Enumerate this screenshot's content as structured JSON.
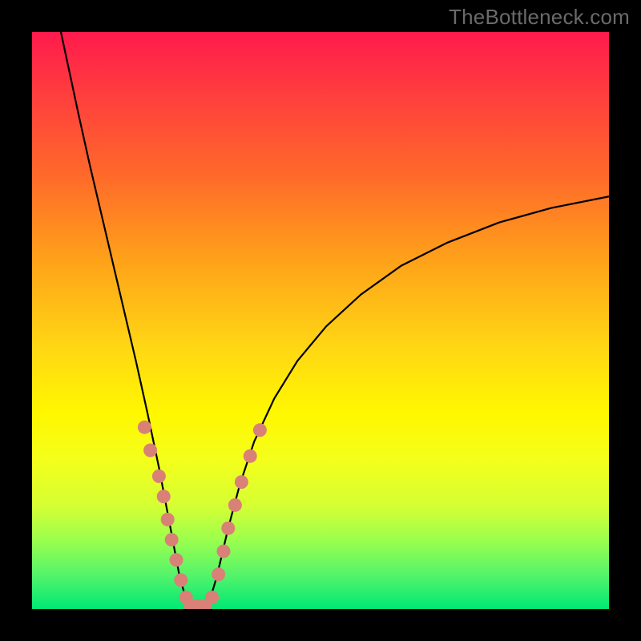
{
  "watermark": "TheBottleneck.com",
  "chart_data": {
    "type": "line",
    "title": "",
    "xlabel": "",
    "ylabel": "",
    "xlim": [
      0,
      100
    ],
    "ylim": [
      0,
      100
    ],
    "curve": {
      "description": "V-shaped bottleneck curve; vertex near x≈27, y≈0; steep left branch rising to top-left; shallower right branch rising to ≈(100,70).",
      "left_branch": [
        {
          "x": 5.0,
          "y": 100.0
        },
        {
          "x": 6.5,
          "y": 93.0
        },
        {
          "x": 8.0,
          "y": 86.0
        },
        {
          "x": 10.0,
          "y": 77.0
        },
        {
          "x": 12.0,
          "y": 68.5
        },
        {
          "x": 14.0,
          "y": 60.0
        },
        {
          "x": 16.0,
          "y": 51.5
        },
        {
          "x": 18.0,
          "y": 43.0
        },
        {
          "x": 20.0,
          "y": 34.0
        },
        {
          "x": 22.0,
          "y": 24.5
        },
        {
          "x": 24.0,
          "y": 14.0
        },
        {
          "x": 25.5,
          "y": 6.0
        },
        {
          "x": 27.0,
          "y": 0.5
        }
      ],
      "right_branch": [
        {
          "x": 30.5,
          "y": 0.5
        },
        {
          "x": 32.0,
          "y": 5.5
        },
        {
          "x": 34.0,
          "y": 14.0
        },
        {
          "x": 36.0,
          "y": 21.5
        },
        {
          "x": 38.5,
          "y": 29.0
        },
        {
          "x": 42.0,
          "y": 36.5
        },
        {
          "x": 46.0,
          "y": 43.0
        },
        {
          "x": 51.0,
          "y": 49.0
        },
        {
          "x": 57.0,
          "y": 54.5
        },
        {
          "x": 64.0,
          "y": 59.5
        },
        {
          "x": 72.0,
          "y": 63.5
        },
        {
          "x": 81.0,
          "y": 67.0
        },
        {
          "x": 90.0,
          "y": 69.5
        },
        {
          "x": 100.0,
          "y": 71.5
        }
      ]
    },
    "markers": [
      {
        "x": 19.5,
        "y": 31.5
      },
      {
        "x": 20.5,
        "y": 27.5
      },
      {
        "x": 22.0,
        "y": 23.0
      },
      {
        "x": 22.8,
        "y": 19.5
      },
      {
        "x": 23.5,
        "y": 15.5
      },
      {
        "x": 24.2,
        "y": 12.0
      },
      {
        "x": 25.0,
        "y": 8.5
      },
      {
        "x": 25.8,
        "y": 5.0
      },
      {
        "x": 26.7,
        "y": 2.0
      },
      {
        "x": 27.5,
        "y": 0.5
      },
      {
        "x": 28.7,
        "y": 0.5
      },
      {
        "x": 30.0,
        "y": 0.5
      },
      {
        "x": 31.2,
        "y": 2.0
      },
      {
        "x": 32.3,
        "y": 6.0
      },
      {
        "x": 33.2,
        "y": 10.0
      },
      {
        "x": 34.0,
        "y": 14.0
      },
      {
        "x": 35.2,
        "y": 18.0
      },
      {
        "x": 36.3,
        "y": 22.0
      },
      {
        "x": 37.8,
        "y": 26.5
      },
      {
        "x": 39.5,
        "y": 31.0
      }
    ],
    "marker_radius_px": 8.5,
    "background_gradient": {
      "top": "#ff1a4d",
      "mid": "#ffd814",
      "bottom": "#00e874"
    }
  }
}
